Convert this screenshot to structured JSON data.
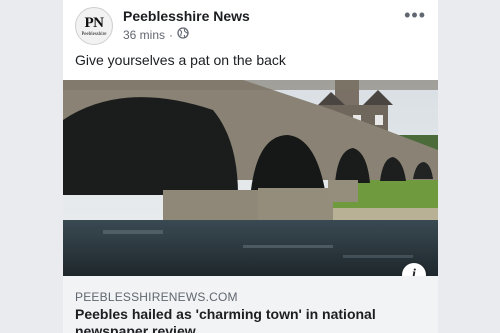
{
  "post": {
    "page_name": "Peeblesshire News",
    "avatar_monogram": "PN",
    "avatar_subtext": "Peeblesshire",
    "timestamp": "36 mins",
    "separator": "·",
    "privacy_icon": "globe-icon",
    "more_icon": "•••",
    "caption": "Give yourselves a pat on the back"
  },
  "link": {
    "domain": "PEEBLESSHIRENEWS.COM",
    "headline": "Peebles hailed as 'charming town' in national newspaper review",
    "info_icon": "i"
  }
}
